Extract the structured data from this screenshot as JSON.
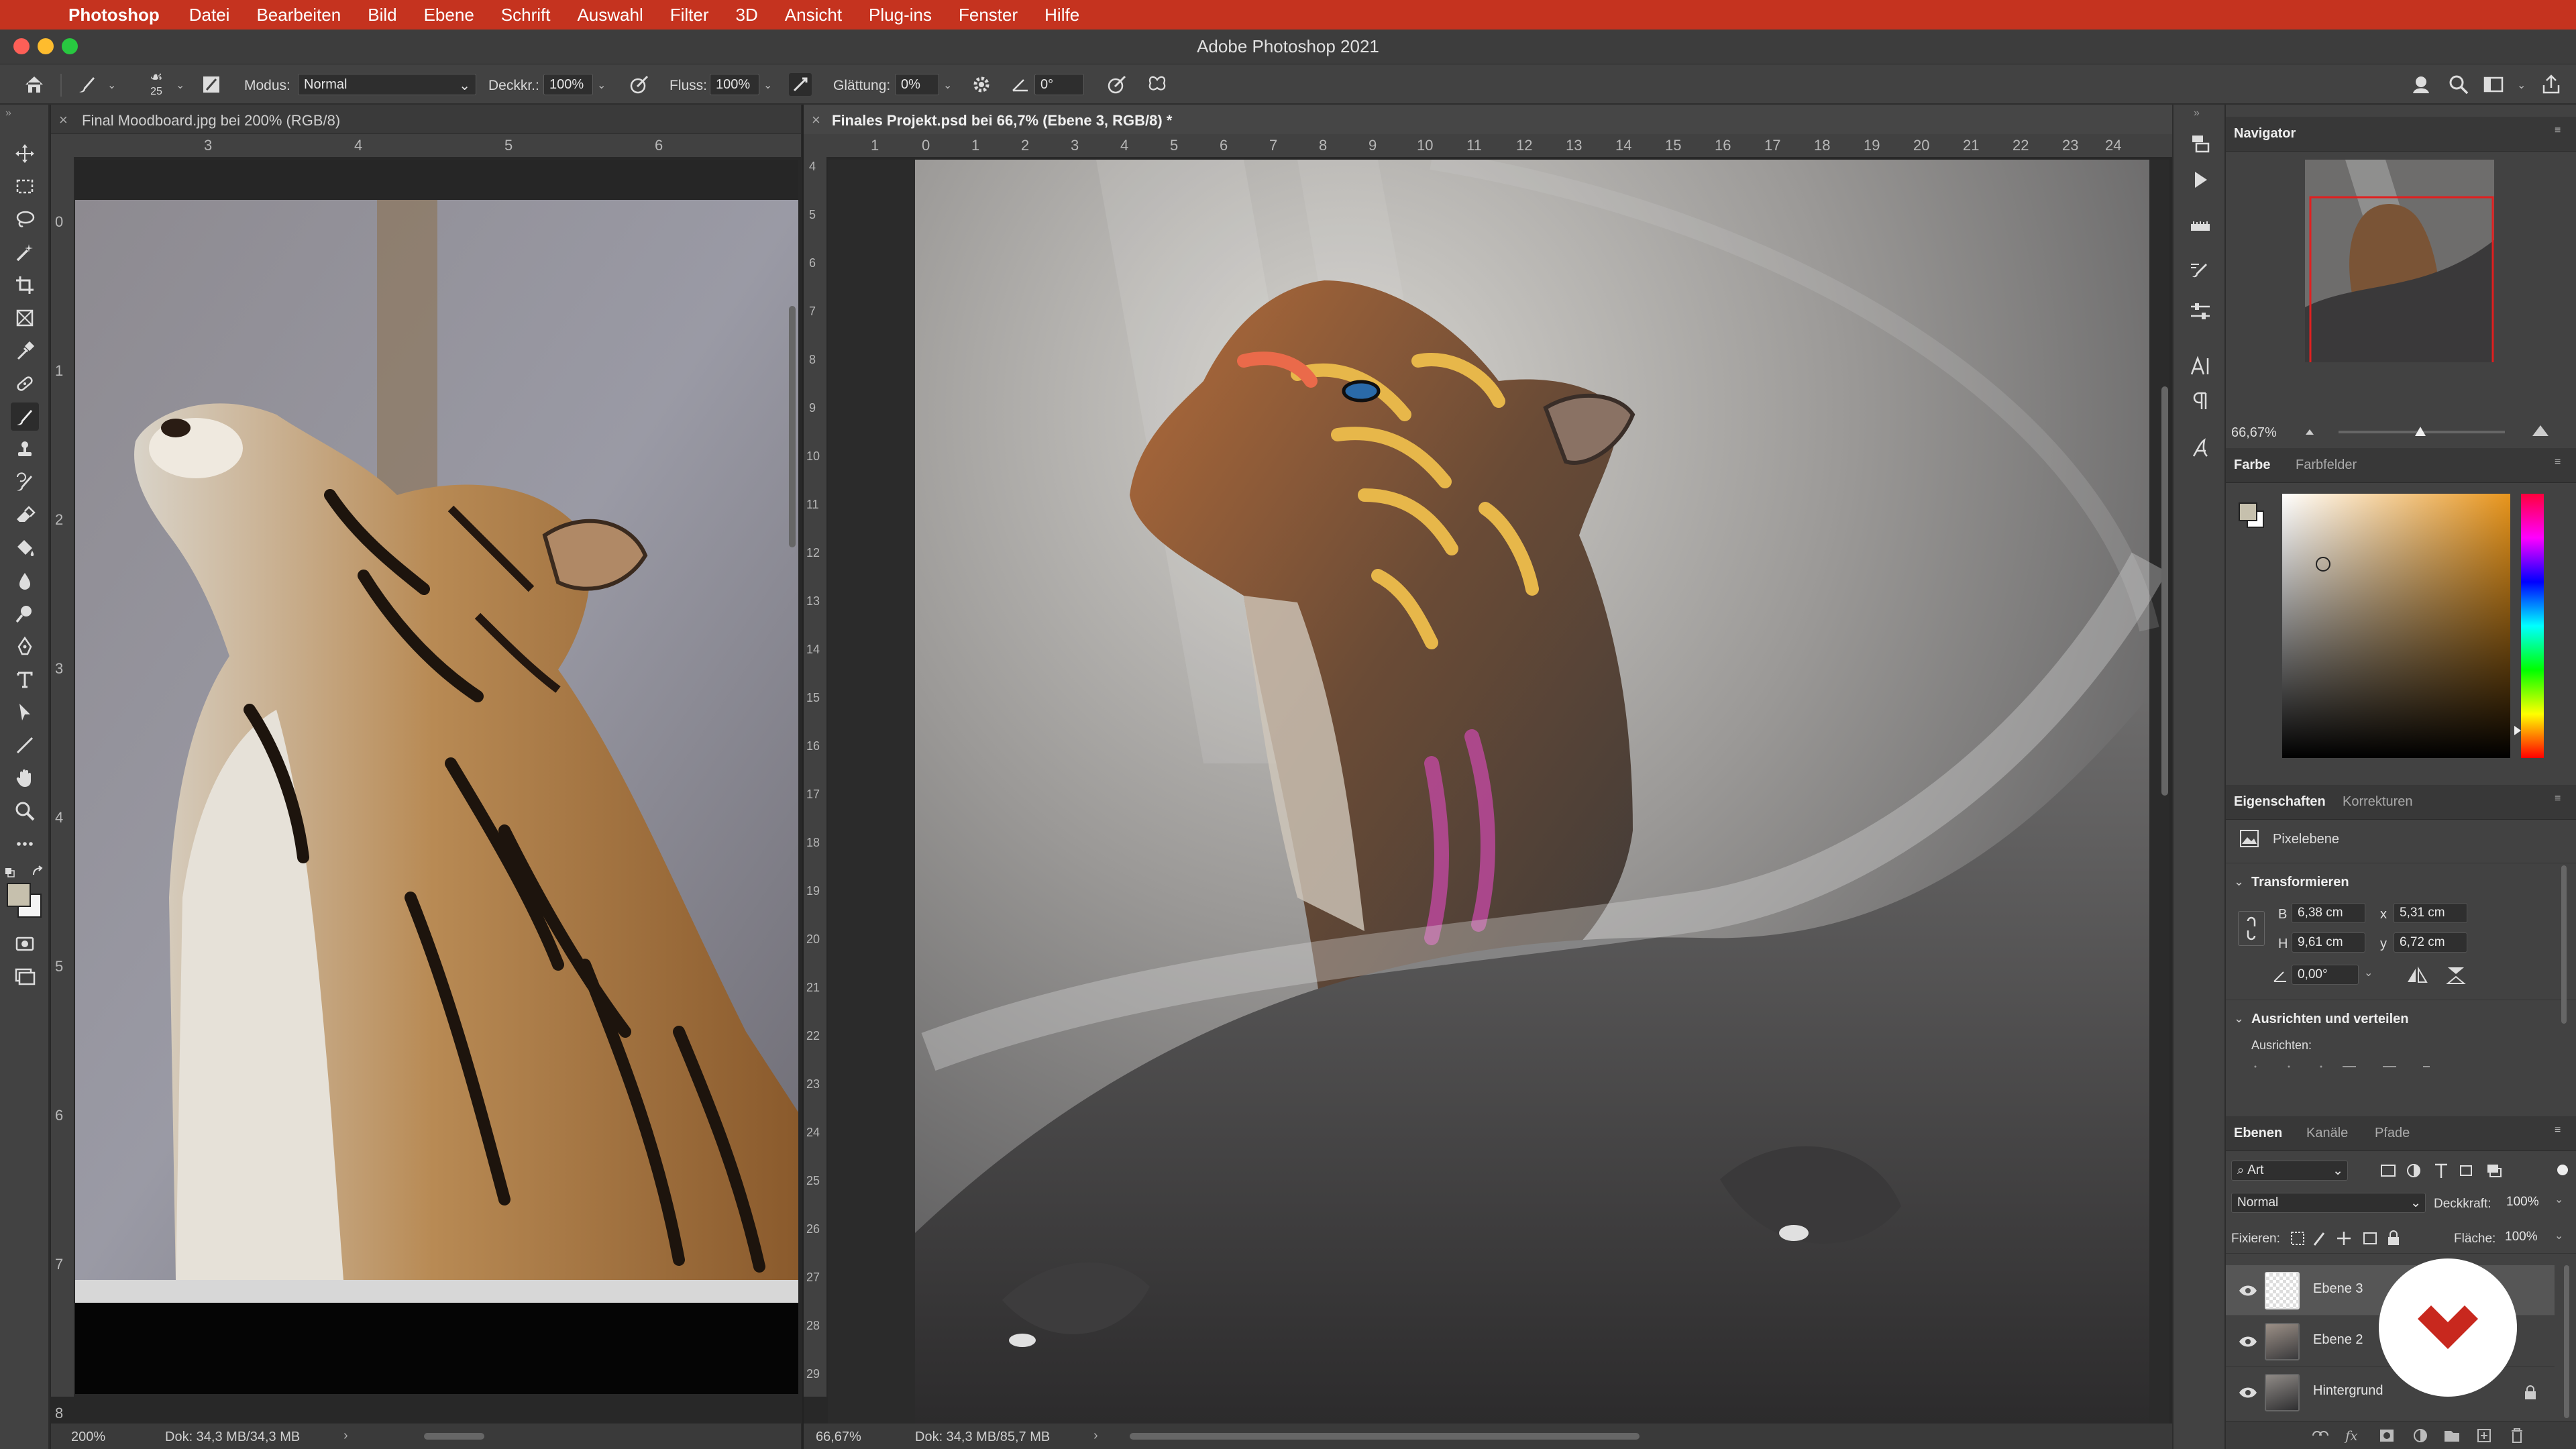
{
  "menubar": {
    "app": "Photoshop",
    "items": [
      "Datei",
      "Bearbeiten",
      "Bild",
      "Ebene",
      "Schrift",
      "Auswahl",
      "Filter",
      "3D",
      "Ansicht",
      "Plug-ins",
      "Fenster",
      "Hilfe"
    ]
  },
  "window": {
    "title": "Adobe Photoshop 2021"
  },
  "options": {
    "brush_size": "25",
    "mode_label": "Modus:",
    "mode_value": "Normal",
    "opacity_label": "Deckkr.:",
    "opacity_value": "100%",
    "flow_label": "Fluss:",
    "flow_value": "100%",
    "smoothing_label": "Glättung:",
    "smoothing_value": "0%",
    "angle_value": "0°"
  },
  "doc_left": {
    "tab": "Final Moodboard.jpg bei 200% (RGB/8)",
    "zoom": "200%",
    "doc_info": "Dok: 34,3 MB/34,3 MB",
    "ruler_h": [
      "3",
      "4",
      "5",
      "6"
    ],
    "ruler_v": [
      "0",
      "1",
      "2",
      "3",
      "4",
      "5",
      "6",
      "7",
      "8"
    ]
  },
  "doc_right": {
    "tab": "Finales Projekt.psd bei 66,7% (Ebene 3, RGB/8) *",
    "zoom": "66,67%",
    "doc_info": "Dok: 34,3 MB/85,7 MB",
    "ruler_h": [
      "1",
      "0",
      "1",
      "2",
      "3",
      "4",
      "5",
      "6",
      "7",
      "8",
      "9",
      "10",
      "11",
      "12",
      "13",
      "14",
      "15",
      "16",
      "17",
      "18",
      "19",
      "20",
      "21",
      "22",
      "23",
      "24"
    ],
    "ruler_v": [
      "4",
      "5",
      "6",
      "7",
      "8",
      "9",
      "10",
      "11",
      "12",
      "13",
      "14",
      "15",
      "16",
      "17",
      "18",
      "19",
      "20",
      "21",
      "22",
      "23",
      "24",
      "25",
      "26",
      "27",
      "28",
      "29"
    ]
  },
  "navigator": {
    "title": "Navigator",
    "zoom": "66,67%"
  },
  "color": {
    "tabs": [
      "Farbe",
      "Farbfelder"
    ]
  },
  "properties": {
    "tabs": [
      "Eigenschaften",
      "Korrekturen"
    ],
    "layer_type": "Pixelebene",
    "transform_title": "Transformieren",
    "w_label": "B",
    "w_value": "6,38 cm",
    "h_label": "H",
    "h_value": "9,61 cm",
    "x_label": "x",
    "x_value": "5,31 cm",
    "y_label": "y",
    "y_value": "6,72 cm",
    "angle_value": "0,00°",
    "align_title": "Ausrichten und verteilen",
    "align_label": "Ausrichten:"
  },
  "layers": {
    "tabs": [
      "Ebenen",
      "Kanäle",
      "Pfade"
    ],
    "filter_kind": "Art",
    "blend_mode": "Normal",
    "opacity_label": "Deckkraft:",
    "opacity_value": "100%",
    "lock_label": "Fixieren:",
    "fill_label": "Fläche:",
    "fill_value": "100%",
    "items": [
      {
        "name": "Ebene 3"
      },
      {
        "name": "Ebene 2"
      },
      {
        "name": "Hintergrund"
      }
    ]
  },
  "colors": {
    "menubar": "#c5331f",
    "panel": "#424242",
    "accent": "#c8281e"
  }
}
